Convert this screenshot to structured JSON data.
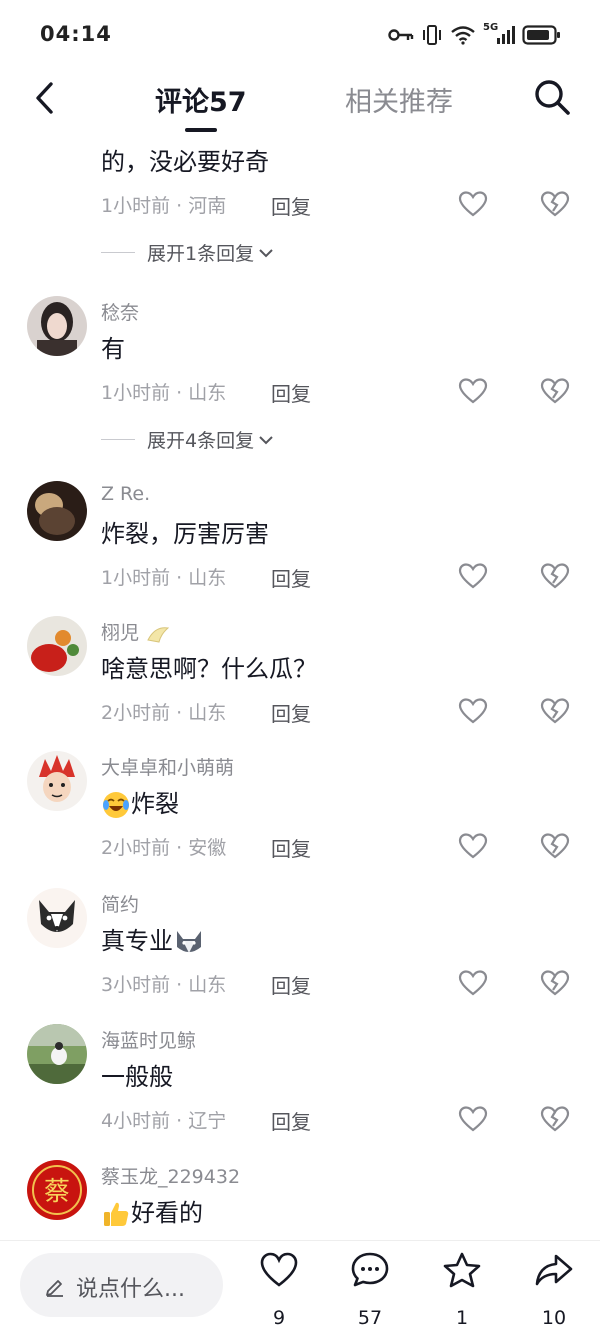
{
  "status": {
    "time": "04:14",
    "network": "5G"
  },
  "nav": {
    "tab_comments": "评论57",
    "tab_related": "相关推荐",
    "icons": [
      "back-arrow-icon",
      "search-icon"
    ]
  },
  "comments": [
    {
      "username": "",
      "content": "的，没必要好奇",
      "time": "1小时前",
      "region": "河南",
      "reply_label": "回复",
      "expand_label": "展开1条回复"
    },
    {
      "username": "稔奈",
      "content": "有",
      "time": "1小时前",
      "region": "山东",
      "reply_label": "回复",
      "expand_label": "展开4条回复"
    },
    {
      "username": "Z Re.",
      "content": "炸裂，厉害厉害",
      "time": "1小时前",
      "region": "山东",
      "reply_label": "回复"
    },
    {
      "username": "栩児",
      "content": "啥意思啊？什么瓜？",
      "time": "2小时前",
      "region": "山东",
      "reply_label": "回复"
    },
    {
      "username": "大卓卓和小萌萌",
      "content": "炸裂",
      "emoji": "laughing-crying-emoji",
      "time": "2小时前",
      "region": "安徽",
      "reply_label": "回复"
    },
    {
      "username": "简约",
      "content": "真专业",
      "emoji": "husky-emoji",
      "time": "3小时前",
      "region": "山东",
      "reply_label": "回复"
    },
    {
      "username": "海蓝时见鲸",
      "content": "一般般",
      "time": "4小时前",
      "region": "辽宁",
      "reply_label": "回复"
    },
    {
      "username": "蔡玉龙_229432",
      "content": "好看的",
      "emoji": "thumbs-up-emoji",
      "avatar_text": "蔡"
    }
  ],
  "bottom": {
    "input_placeholder": "说点什么...",
    "likes": "9",
    "comments": "57",
    "favorites": "1",
    "shares": "10"
  },
  "colors": {
    "primary_text": "#161823",
    "secondary_text": "#8a8b91",
    "background": "#ffffff"
  }
}
